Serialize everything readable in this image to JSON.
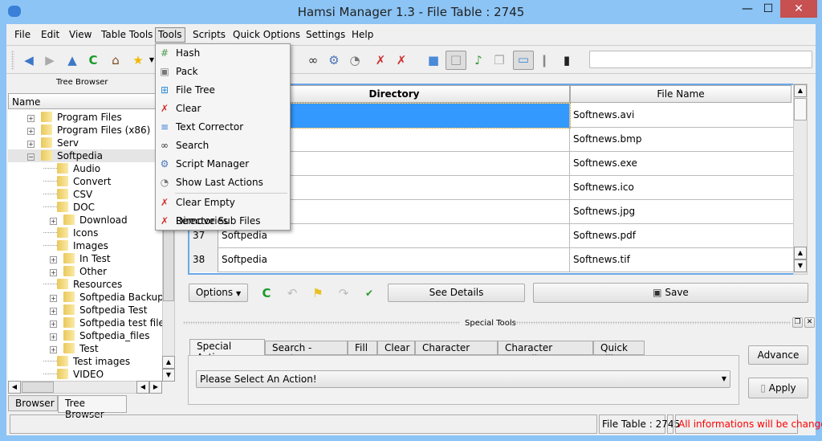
{
  "window": {
    "title": "Hamsi Manager 1.3 - File Table : 2745",
    "minimize": "—",
    "maximize": "☐",
    "close": "✕"
  },
  "menubar": [
    "File",
    "Edit",
    "View",
    "Table Tools",
    "Tools",
    "Scripts",
    "Quick Options",
    "Settings",
    "Help"
  ],
  "tools_menu": [
    {
      "label": "Hash",
      "icon": "hash-icon",
      "glyph": "#"
    },
    {
      "label": "Pack",
      "icon": "pack-icon",
      "glyph": "▣"
    },
    {
      "label": "File Tree",
      "icon": "file-tree-icon",
      "glyph": "⊞"
    },
    {
      "label": "Clear",
      "icon": "clear-icon",
      "glyph": "✗"
    },
    {
      "label": "Text Corrector",
      "icon": "text-corrector-icon",
      "glyph": "≡"
    },
    {
      "label": "Search",
      "icon": "binoculars-icon",
      "glyph": "∞"
    },
    {
      "label": "Script Manager",
      "icon": "gear-icon",
      "glyph": "⚙"
    },
    {
      "label": "Show Last Actions",
      "icon": "stopwatch-icon",
      "glyph": "◔"
    },
    {
      "label": "Clear Empty Directories",
      "icon": "clear-folder-icon",
      "glyph": "✗"
    },
    {
      "label": "Remove Sub Files",
      "icon": "remove-files-icon",
      "glyph": "✗"
    }
  ],
  "tree_browser": {
    "title": "Tree Browser",
    "column": "Name",
    "items": [
      {
        "label": "Program Files",
        "level": 0,
        "expandable": true
      },
      {
        "label": "Program Files (x86)",
        "level": 0,
        "expandable": true
      },
      {
        "label": "Serv",
        "level": 0,
        "expandable": true
      },
      {
        "label": "Softpedia",
        "level": 0,
        "expandable": true,
        "expanded": true,
        "selected": true
      },
      {
        "label": "Audio",
        "level": 1
      },
      {
        "label": "Convert",
        "level": 1
      },
      {
        "label": "CSV",
        "level": 1
      },
      {
        "label": "DOC",
        "level": 1
      },
      {
        "label": "Download",
        "level": 1,
        "expandable": true
      },
      {
        "label": "Icons",
        "level": 1
      },
      {
        "label": "Images",
        "level": 1
      },
      {
        "label": "In Test",
        "level": 1,
        "expandable": true
      },
      {
        "label": "Other",
        "level": 1,
        "expandable": true
      },
      {
        "label": "Resources",
        "level": 1
      },
      {
        "label": "Softpedia Backup",
        "level": 1,
        "expandable": true
      },
      {
        "label": "Softpedia Test",
        "level": 1,
        "expandable": true
      },
      {
        "label": "Softpedia test files",
        "level": 1,
        "expandable": true
      },
      {
        "label": "Softpedia_files",
        "level": 1,
        "expandable": true
      },
      {
        "label": "Test",
        "level": 1,
        "expandable": true
      },
      {
        "label": "Test images",
        "level": 1
      },
      {
        "label": "VIDEO",
        "level": 1
      }
    ],
    "tabs": [
      "Browser",
      "Tree Browser"
    ],
    "active_tab": "Tree Browser"
  },
  "table": {
    "columns": [
      "Directory",
      "File Name"
    ],
    "rows": [
      {
        "num": "",
        "dir": "",
        "file": "Softnews.avi",
        "selected": true
      },
      {
        "num": "",
        "dir": "",
        "file": "Softnews.bmp"
      },
      {
        "num": "",
        "dir": "",
        "file": "Softnews.exe"
      },
      {
        "num": "",
        "dir": "",
        "file": "Softnews.ico"
      },
      {
        "num": "",
        "dir": "",
        "file": "Softnews.jpg"
      },
      {
        "num": "37",
        "dir": "Softpedia",
        "file": "Softnews.pdf"
      },
      {
        "num": "38",
        "dir": "Softpedia",
        "file": "Softnews.tif"
      }
    ]
  },
  "actions": {
    "options": "Options",
    "see_details": "See Details",
    "save": "Save"
  },
  "special_tools": {
    "title": "Special Tools",
    "tabs": [
      "Special Actions",
      "Search - Replace",
      "Fill",
      "Clear",
      "Character State",
      "Character Encoding",
      "Quick Fill"
    ],
    "active_tab": "Special Actions",
    "select_value": "Please Select An Action!",
    "advance": "Advance",
    "apply": "Apply"
  },
  "status": {
    "file_table": "File Table : 2745",
    "warning": "All informations will be changed",
    "warning_color": "#ff0000"
  },
  "colors": {
    "titlebar": "#8cc4f5",
    "selection": "#3399ff",
    "close_button": "#c75050"
  }
}
